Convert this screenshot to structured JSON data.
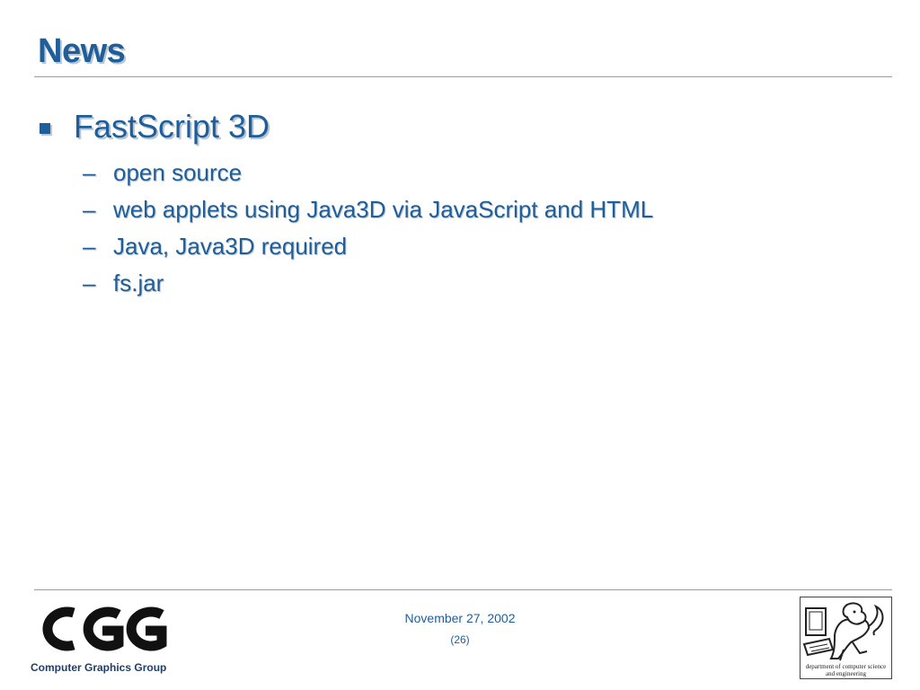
{
  "slide": {
    "title": "News",
    "bullets": [
      {
        "text": "FastScript 3D",
        "subitems": [
          "open source",
          "web applets using Java3D via JavaScript and HTML",
          "Java, Java3D required",
          "fs.jar"
        ]
      }
    ]
  },
  "footer": {
    "date": "November 27, 2002",
    "page_number": "(26)",
    "group_name": "Computer Graphics Group",
    "logo_text": "CGG",
    "department_line1": "department of computer science",
    "department_line2": "and engineering"
  },
  "colors": {
    "accent": "#1f5e98",
    "shadow": "#b9c6d3",
    "rule": "#9c9c9c"
  }
}
